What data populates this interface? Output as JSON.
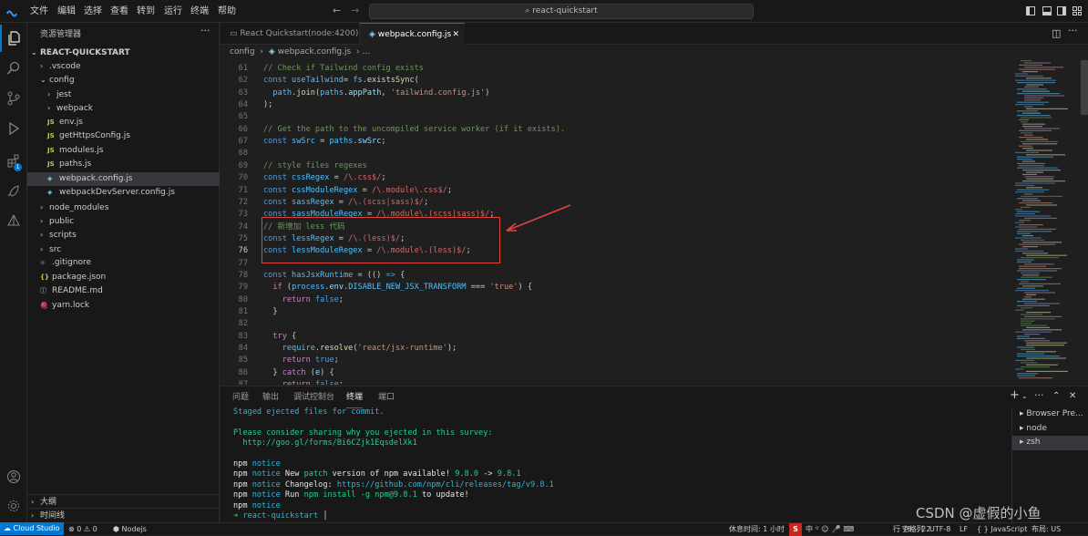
{
  "menu": [
    "文件",
    "编辑",
    "选择",
    "查看",
    "转到",
    "运行",
    "终端",
    "帮助"
  ],
  "search": {
    "text": "react-quickstart"
  },
  "sidebar": {
    "title": "资源管理器",
    "root": "REACT-QUICKSTART",
    "items": [
      {
        "label": ".vscode",
        "kind": "folder",
        "open": false,
        "depth": 1
      },
      {
        "label": "config",
        "kind": "folder",
        "open": true,
        "depth": 1
      },
      {
        "label": "jest",
        "kind": "folder",
        "open": false,
        "depth": 2
      },
      {
        "label": "webpack",
        "kind": "folder",
        "open": false,
        "depth": 2
      },
      {
        "label": "env.js",
        "kind": "js",
        "depth": 2
      },
      {
        "label": "getHttpsConfig.js",
        "kind": "js",
        "depth": 2
      },
      {
        "label": "modules.js",
        "kind": "js",
        "depth": 2
      },
      {
        "label": "paths.js",
        "kind": "js",
        "depth": 2
      },
      {
        "label": "webpack.config.js",
        "kind": "webpack",
        "depth": 2,
        "selected": true
      },
      {
        "label": "webpackDevServer.config.js",
        "kind": "webpack",
        "depth": 2
      },
      {
        "label": "node_modules",
        "kind": "folder",
        "open": false,
        "depth": 1
      },
      {
        "label": "public",
        "kind": "folder",
        "open": false,
        "depth": 1
      },
      {
        "label": "scripts",
        "kind": "folder",
        "open": false,
        "depth": 1
      },
      {
        "label": "src",
        "kind": "folder",
        "open": false,
        "depth": 1
      },
      {
        "label": ".gitignore",
        "kind": "git",
        "depth": 1
      },
      {
        "label": "package.json",
        "kind": "json",
        "depth": 1
      },
      {
        "label": "README.md",
        "kind": "md",
        "depth": 1
      },
      {
        "label": "yarn.lock",
        "kind": "yarn",
        "depth": 1
      }
    ],
    "outline": "大纲",
    "timeline": "时间线"
  },
  "tabs": [
    {
      "label": "React Quickstart(node:4200)",
      "active": false
    },
    {
      "label": "webpack.config.js",
      "active": true
    }
  ],
  "breadcrumb": [
    "config",
    "webpack.config.js"
  ],
  "editor": {
    "lines": [
      {
        "n": "61",
        "t": [
          [
            "cm",
            "// Check if Tailwind config exists"
          ]
        ]
      },
      {
        "n": "62",
        "t": [
          [
            "kw",
            "const "
          ],
          [
            "var",
            "useTailwind"
          ],
          [
            "",
            "= "
          ],
          [
            "var",
            "fs"
          ],
          [
            "",
            "."
          ],
          [
            "fn",
            "existsSync"
          ],
          [
            "",
            "("
          ]
        ]
      },
      {
        "n": "63",
        "t": [
          [
            "",
            "  "
          ],
          [
            "var",
            "path"
          ],
          [
            "",
            "."
          ],
          [
            "fn",
            "join"
          ],
          [
            "",
            "("
          ],
          [
            "var",
            "paths"
          ],
          [
            "",
            "."
          ],
          [
            "prop",
            "appPath"
          ],
          [
            "",
            ", "
          ],
          [
            "str",
            "'tailwind.config.js'"
          ],
          [
            "",
            ")"
          ]
        ]
      },
      {
        "n": "64",
        "t": [
          [
            "",
            ");"
          ]
        ]
      },
      {
        "n": "65",
        "t": []
      },
      {
        "n": "66",
        "t": [
          [
            "cm",
            "// Get the path to the uncompiled service worker (if it exists)."
          ]
        ]
      },
      {
        "n": "67",
        "t": [
          [
            "kw",
            "const "
          ],
          [
            "var",
            "swSrc"
          ],
          [
            "",
            " = "
          ],
          [
            "var",
            "paths"
          ],
          [
            "",
            "."
          ],
          [
            "prop",
            "swSrc"
          ],
          [
            "",
            ";"
          ]
        ]
      },
      {
        "n": "68",
        "t": []
      },
      {
        "n": "69",
        "t": [
          [
            "cm",
            "// style files regexes"
          ]
        ]
      },
      {
        "n": "70",
        "t": [
          [
            "kw",
            "const "
          ],
          [
            "var",
            "cssRegex"
          ],
          [
            "",
            " = "
          ],
          [
            "rx",
            "/\\.css$/"
          ],
          [
            "",
            ";"
          ]
        ]
      },
      {
        "n": "71",
        "t": [
          [
            "kw",
            "const "
          ],
          [
            "var",
            "cssModuleRegex"
          ],
          [
            "",
            " = "
          ],
          [
            "rx",
            "/\\.module\\.css$/"
          ],
          [
            "",
            ";"
          ]
        ]
      },
      {
        "n": "72",
        "t": [
          [
            "kw",
            "const "
          ],
          [
            "var",
            "sassRegex"
          ],
          [
            "",
            " = "
          ],
          [
            "rx",
            "/\\.(scss|sass)$/"
          ],
          [
            "",
            ";"
          ]
        ]
      },
      {
        "n": "73",
        "t": [
          [
            "kw",
            "const "
          ],
          [
            "var",
            "sassModuleRegex"
          ],
          [
            "",
            " = "
          ],
          [
            "rx",
            "/\\.module\\.(scss|sass)$/"
          ],
          [
            "",
            ";"
          ]
        ]
      },
      {
        "n": "74",
        "t": [
          [
            "cm",
            "// 新增加 less 代码"
          ]
        ]
      },
      {
        "n": "75",
        "t": [
          [
            "kw",
            "const "
          ],
          [
            "var",
            "lessRegex"
          ],
          [
            "",
            " = "
          ],
          [
            "rx",
            "/\\.(less)$/"
          ],
          [
            "",
            ";"
          ]
        ]
      },
      {
        "n": "76",
        "t": [
          [
            "kw",
            "const "
          ],
          [
            "var",
            "lessModuleRegex"
          ],
          [
            "",
            " = "
          ],
          [
            "rx",
            "/\\.module\\.(less)$/"
          ],
          [
            "",
            ";"
          ]
        ],
        "cur": true
      },
      {
        "n": "77",
        "t": []
      },
      {
        "n": "78",
        "t": [
          [
            "kw",
            "const "
          ],
          [
            "var",
            "hasJsxRuntime"
          ],
          [
            "",
            " = (() "
          ],
          [
            "kw",
            "=>"
          ],
          [
            "",
            " {"
          ]
        ]
      },
      {
        "n": "79",
        "t": [
          [
            "",
            "  "
          ],
          [
            "ctl",
            "if"
          ],
          [
            "",
            " ("
          ],
          [
            "var",
            "process"
          ],
          [
            "",
            "."
          ],
          [
            "prop",
            "env"
          ],
          [
            "",
            "."
          ],
          [
            "var",
            "DISABLE_NEW_JSX_TRANSFORM"
          ],
          [
            "",
            " === "
          ],
          [
            "str",
            "'true'"
          ],
          [
            "",
            ") {"
          ]
        ]
      },
      {
        "n": "80",
        "t": [
          [
            "",
            "    "
          ],
          [
            "ctl",
            "return "
          ],
          [
            "kw",
            "false"
          ],
          [
            "",
            ";"
          ]
        ]
      },
      {
        "n": "81",
        "t": [
          [
            "",
            "  }"
          ]
        ]
      },
      {
        "n": "82",
        "t": []
      },
      {
        "n": "83",
        "t": [
          [
            "",
            "  "
          ],
          [
            "ctl",
            "try"
          ],
          [
            "",
            " {"
          ]
        ]
      },
      {
        "n": "84",
        "t": [
          [
            "",
            "    "
          ],
          [
            "var",
            "require"
          ],
          [
            "",
            "."
          ],
          [
            "fn",
            "resolve"
          ],
          [
            "",
            "("
          ],
          [
            "str",
            "'react/jsx-runtime'"
          ],
          [
            "",
            ");"
          ]
        ]
      },
      {
        "n": "85",
        "t": [
          [
            "",
            "    "
          ],
          [
            "ctl",
            "return "
          ],
          [
            "kw",
            "true"
          ],
          [
            "",
            ";"
          ]
        ]
      },
      {
        "n": "86",
        "t": [
          [
            "",
            "  } "
          ],
          [
            "ctl",
            "catch"
          ],
          [
            "",
            " ("
          ],
          [
            "prop",
            "e"
          ],
          [
            "",
            ") {"
          ]
        ]
      },
      {
        "n": "87",
        "t": [
          [
            "",
            "    "
          ],
          [
            "ctl",
            "return "
          ],
          [
            "kw",
            "false"
          ],
          [
            "",
            ";"
          ]
        ]
      }
    ]
  },
  "panel": {
    "tabs": [
      "问题",
      "输出",
      "调试控制台",
      "终端",
      "端口"
    ],
    "active_tab": "终端",
    "terminal": [
      [
        [
          "cyan",
          "Staged ejected files for commit."
        ]
      ],
      [],
      [
        [
          "green",
          "Please consider sharing why you ejected in this survey:"
        ]
      ],
      [
        [
          "green",
          "  http://goo.gl/forms/Bi6CZjk1EqsdelXk1"
        ]
      ],
      [],
      [
        [
          "white",
          "npm "
        ],
        [
          "cyan",
          "notice"
        ]
      ],
      [
        [
          "white",
          "npm "
        ],
        [
          "cyan",
          "notice "
        ],
        [
          "white",
          "New "
        ],
        [
          "green",
          "patch"
        ],
        [
          "white",
          " version of npm available! "
        ],
        [
          "green",
          "9.8.0"
        ],
        [
          "white",
          " -> "
        ],
        [
          "green",
          "9.8.1"
        ]
      ],
      [
        [
          "white",
          "npm "
        ],
        [
          "cyan",
          "notice "
        ],
        [
          "white",
          "Changelog: "
        ],
        [
          "cyan",
          "https://github.com/npm/cli/releases/tag/v9.8.1"
        ]
      ],
      [
        [
          "white",
          "npm "
        ],
        [
          "cyan",
          "notice "
        ],
        [
          "white",
          "Run "
        ],
        [
          "green",
          "npm install -g npm@9.8.1"
        ],
        [
          "white",
          " to update!"
        ]
      ],
      [
        [
          "white",
          "npm "
        ],
        [
          "cyan",
          "notice"
        ]
      ],
      [
        [
          "green",
          "➜ "
        ],
        [
          "cyan",
          "react-quickstart "
        ],
        [
          "white",
          "│"
        ]
      ]
    ],
    "terminal_list": [
      "Browser Pre...",
      "node",
      "zsh"
    ]
  },
  "status": {
    "remote": "Cloud Studio",
    "problems": "⊗ 0 ⚠ 0",
    "nodejs": "Nodejs",
    "rest_time": "休息时间: 1 小时",
    "position": "行 76, 列 2",
    "spaces": "空格: 2",
    "encoding": "UTF-8",
    "eol": "LF",
    "language": "{ } JavaScript",
    "layout": "布局: US"
  },
  "watermark": "CSDN @虚假的小鱼"
}
